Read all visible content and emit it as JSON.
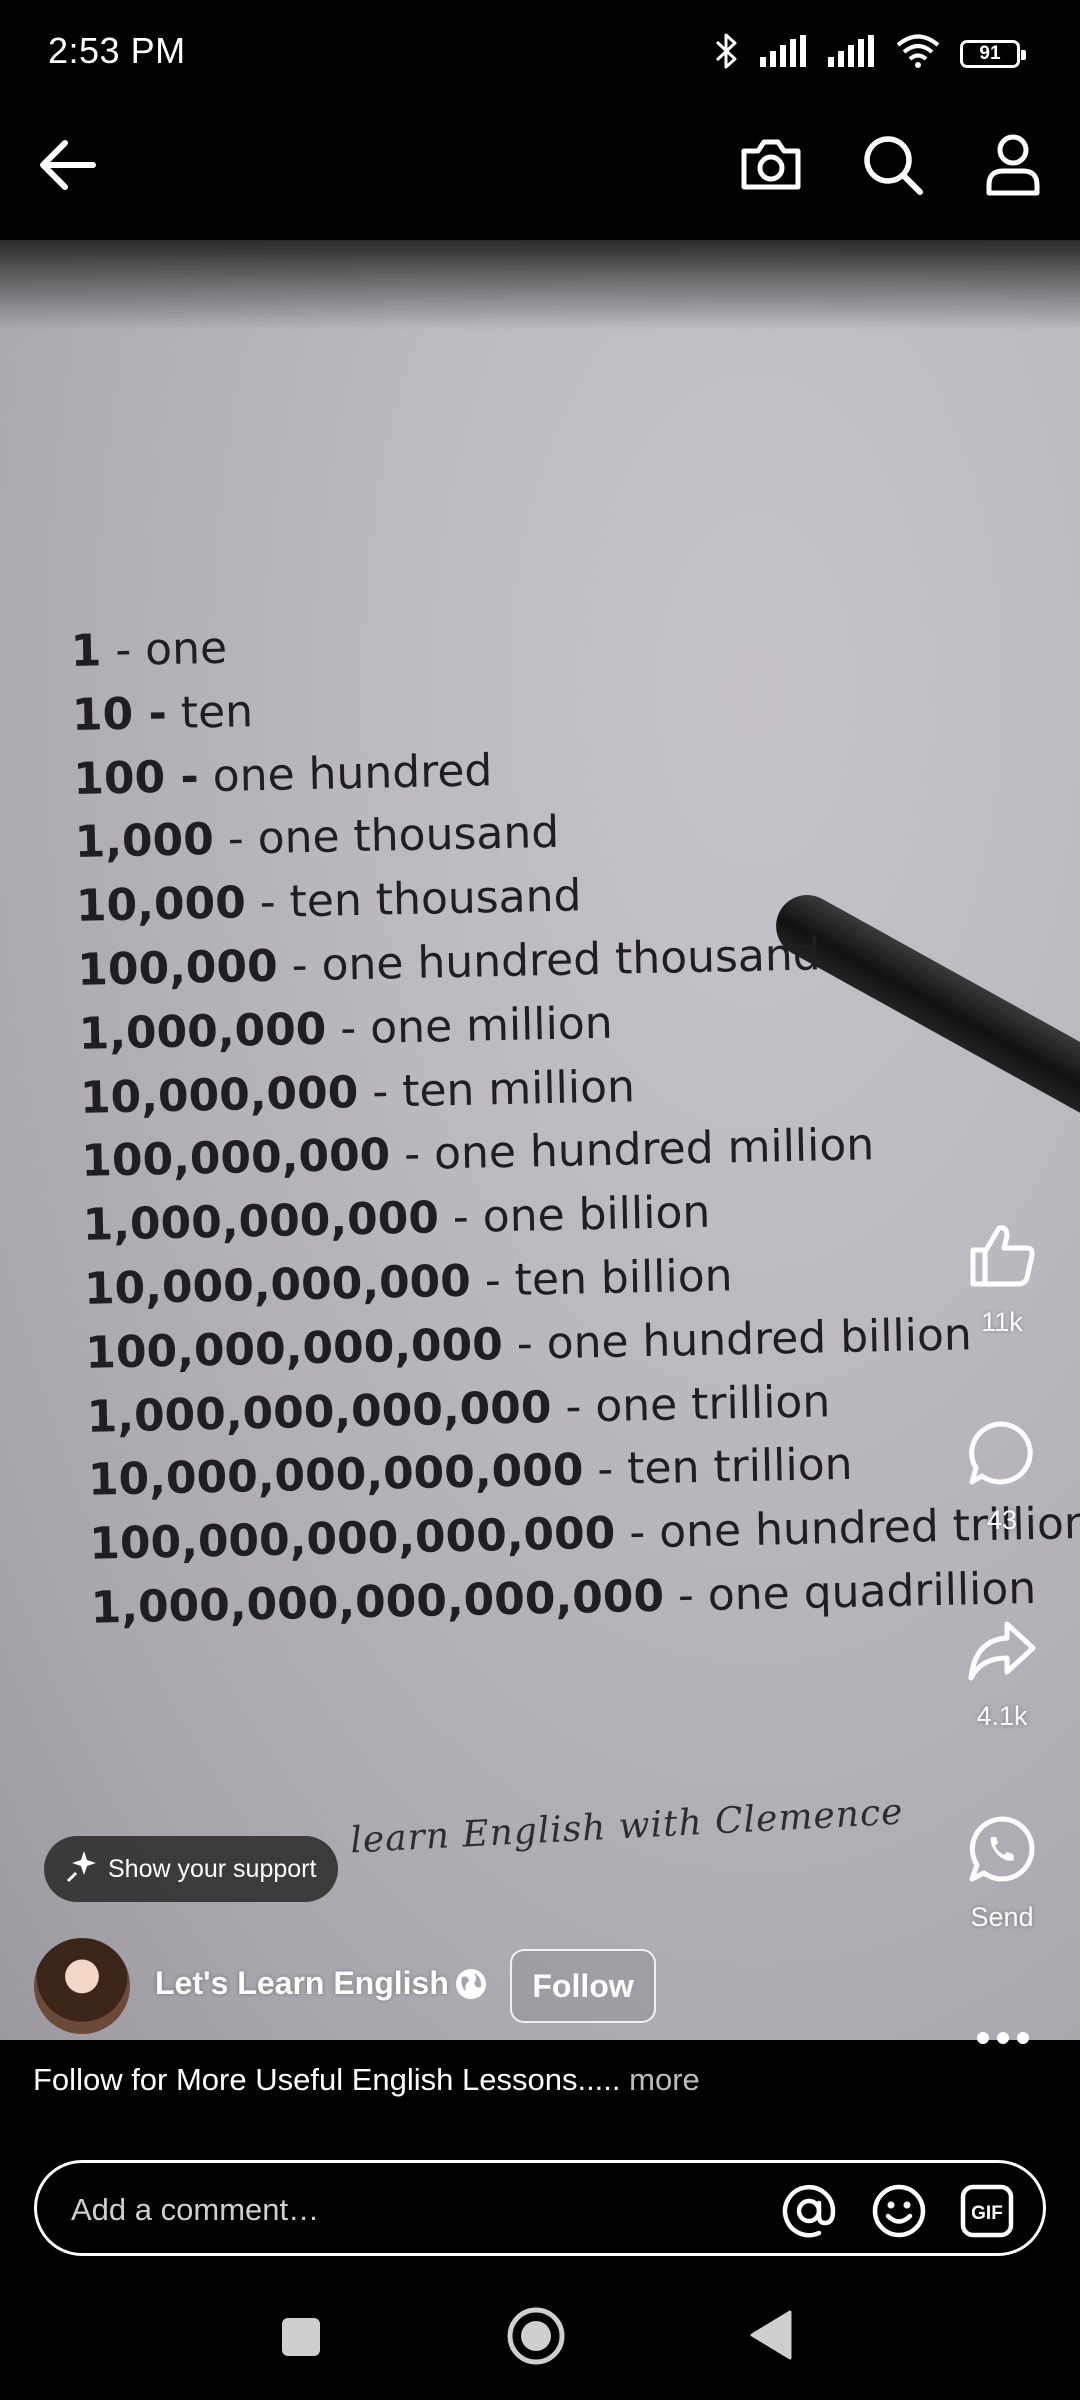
{
  "status_bar": {
    "time": "2:53 PM",
    "battery": "91",
    "icons": [
      "bluetooth-icon",
      "signal-icon",
      "signal-icon",
      "wifi-icon",
      "battery-icon"
    ]
  },
  "top_nav": {
    "icons": [
      "back-arrow-icon",
      "camera-icon",
      "search-icon",
      "profile-icon"
    ]
  },
  "video": {
    "lines": [
      {
        "num": "1",
        "word": " - one"
      },
      {
        "num": "10 -",
        "word": " ten"
      },
      {
        "num": "100 -",
        "word": " one hundred"
      },
      {
        "num": "1,000",
        "word": " - one thousand"
      },
      {
        "num": "10,000",
        "word": " - ten thousand"
      },
      {
        "num": "100,000",
        "word": " - one hundred thousand"
      },
      {
        "num": "1,000,000",
        "word": " - one million"
      },
      {
        "num": "10,000,000",
        "word": " - ten million"
      },
      {
        "num": "100,000,000",
        "word": " - one hundred million"
      },
      {
        "num": "1,000,000,000",
        "word": " - one billion"
      },
      {
        "num": "10,000,000,000",
        "word": " - ten billion"
      },
      {
        "num": "100,000,000,000",
        "word": " - one hundred billion"
      },
      {
        "num": "1,000,000,000,000",
        "word": " - one trillion"
      },
      {
        "num": "10,000,000,000,000",
        "word": " - ten trillion"
      },
      {
        "num": "100,000,000,000,000",
        "word": " - one hundred trillion"
      },
      {
        "num": "1,000,000,000,000,000",
        "word": " - one quadrillion"
      }
    ],
    "signature": "learn English with Clemence"
  },
  "actions": {
    "like_count": "11k",
    "comment_count": "43",
    "share_count": "4.1k",
    "send_label": "Send"
  },
  "support": {
    "label": "Show your support"
  },
  "author": {
    "name": "Let's Learn English",
    "follow_label": "Follow"
  },
  "caption": {
    "text": "Follow for More Useful English Lessons..... ",
    "more": "more"
  },
  "comment": {
    "placeholder": "Add a comment…",
    "icons": [
      "mention-icon",
      "emoji-icon",
      "gif-icon"
    ]
  },
  "system_nav": {
    "icons": [
      "recents-square-icon",
      "home-circle-icon",
      "back-triangle-icon"
    ]
  },
  "colors": {
    "background": "#000000",
    "paper": "#bdbbc1",
    "text_dark": "#1f1f22"
  }
}
